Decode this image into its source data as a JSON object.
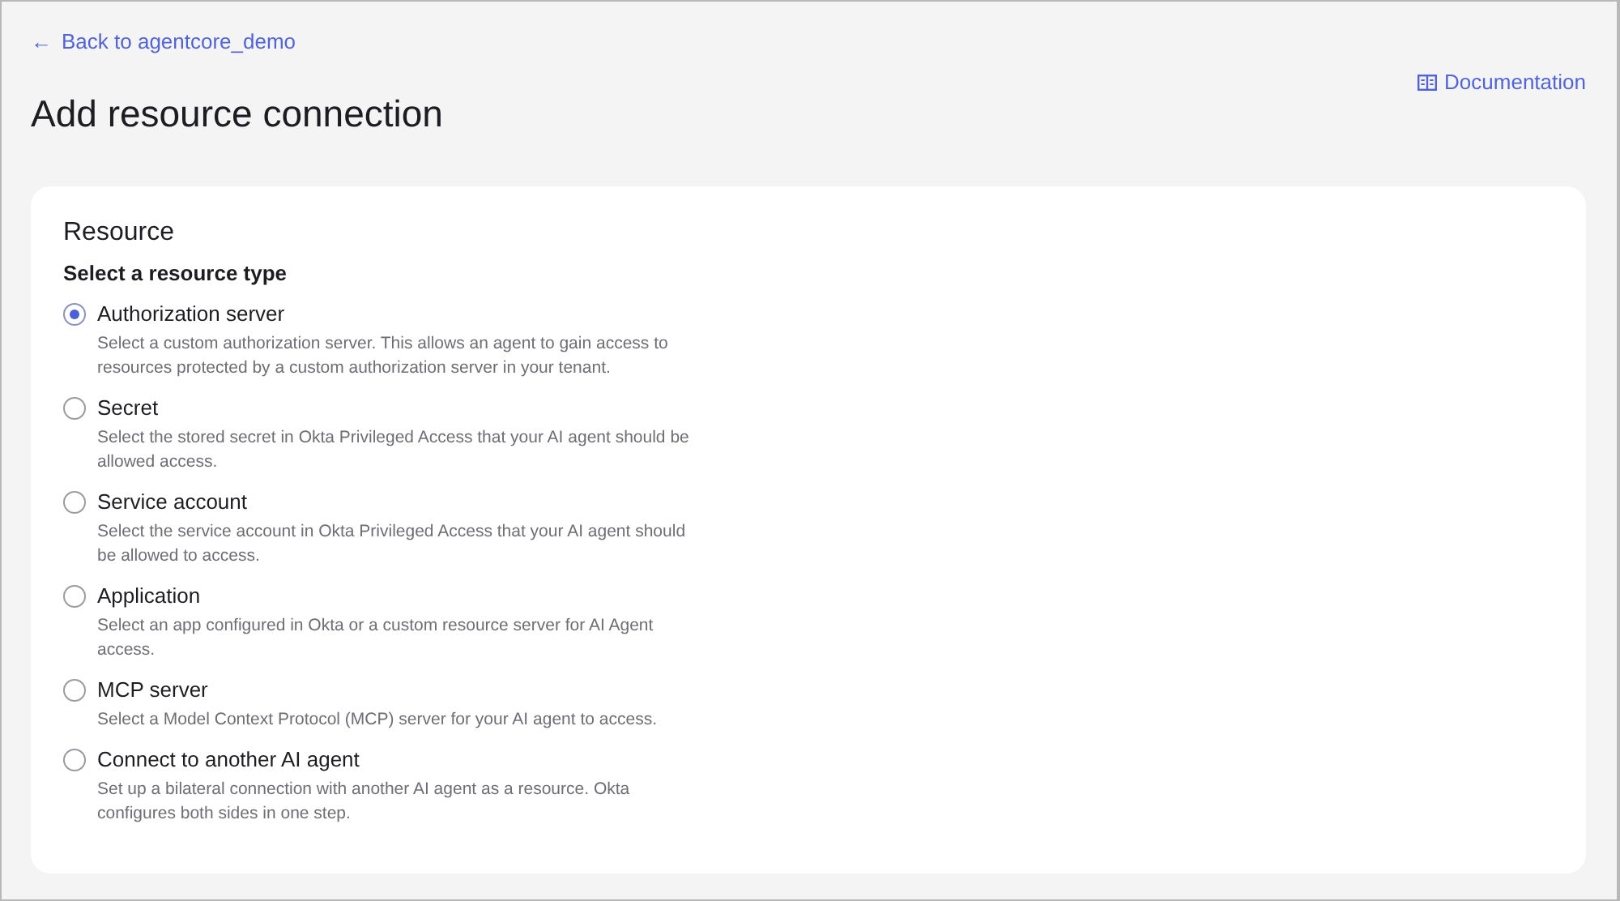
{
  "back_link": {
    "arrow": "←",
    "label": "Back to agentcore_demo"
  },
  "title": "Add resource connection",
  "documentation_link": {
    "label": "Documentation"
  },
  "resource": {
    "heading": "Resource",
    "group_label": "Select a resource type",
    "options": [
      {
        "label": "Authorization server",
        "description": "Select a custom authorization server. This allows an agent to gain access to resources protected by a custom authorization server in your tenant.",
        "selected": true
      },
      {
        "label": "Secret",
        "description": "Select the stored secret in Okta Privileged Access that your AI agent should be allowed access.",
        "selected": false
      },
      {
        "label": "Service account",
        "description": "Select the service account in Okta Privileged Access that your AI agent should be allowed to access.",
        "selected": false
      },
      {
        "label": "Application",
        "description": "Select an app configured in Okta or a custom resource server for AI Agent access.",
        "selected": false
      },
      {
        "label": "MCP server",
        "description": "Select a Model Context Protocol (MCP) server for your AI agent to access.",
        "selected": false
      },
      {
        "label": "Connect to another AI agent",
        "description": "Set up a bilateral connection with another AI agent as a resource. Okta configures both sides in one step.",
        "selected": false
      }
    ]
  }
}
